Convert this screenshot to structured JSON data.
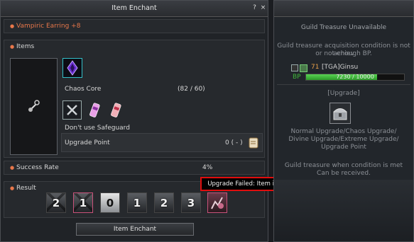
{
  "enchant_window": {
    "title": "Item Enchant",
    "help_icon": "?",
    "close_icon": "×",
    "target_item": "Vampiric Earring +8",
    "items_header": "Items",
    "material": {
      "name": "Chaos Core",
      "count": "(82 / 60)"
    },
    "safeguard_label": "Don't use Safeguard",
    "upgrade_point_label": "Upgrade Point",
    "upgrade_point_value": "0 ( - )",
    "success_rate_label": "Success Rate",
    "success_rate_value": "4%",
    "result_label": "Result",
    "result_levels": [
      "2",
      "1",
      "0",
      "1",
      "2",
      "3"
    ],
    "enchant_button": "Item Enchant"
  },
  "tooltip": {
    "text": "Upgrade Failed: Item is destroyed"
  },
  "guild_panel": {
    "header": "Guild Treasure Unavailable",
    "condition_line1": "Guild treasure acquisition condition is not achiev",
    "condition_line2": "or not enough BP.",
    "member_level": "71",
    "member_name": "[TGA]Ginsu",
    "bp_label": "BP",
    "bp_value": "7230 / 10000",
    "bp_fill": 0.723,
    "upgrade_label": "[Upgrade]",
    "upgrade_desc_1": "Normal Upgrade/Chaos Upgrade/",
    "upgrade_desc_2": "Divine Upgrade/Extreme Upgrade/",
    "upgrade_desc_3": "Upgrade Point",
    "receive_line1": "Guild treasure when condition is met",
    "receive_line2": "Can be received."
  },
  "colors": {
    "accent_orange": "#e8774a",
    "bp_green": "#3fb83a",
    "tooltip_border": "#e10d0d"
  }
}
